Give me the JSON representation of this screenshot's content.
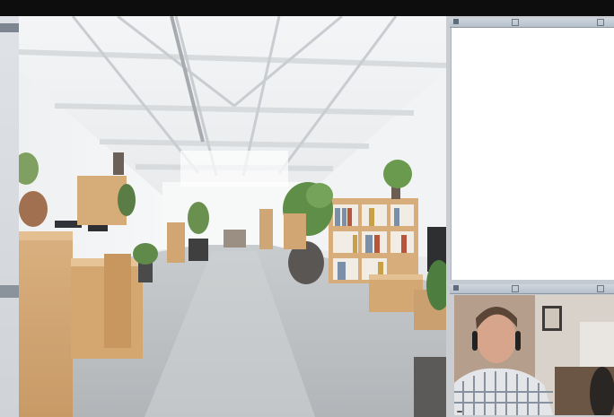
{
  "window": {
    "shared_content": "office-photo-image"
  },
  "notes_panel": {
    "title": "",
    "icons": [
      "panel-icon",
      "restore-icon",
      "close-icon"
    ]
  },
  "video_panel": {
    "title": "",
    "participant_name": "",
    "icons": [
      "panel-icon",
      "restore-icon",
      "close-icon"
    ]
  }
}
